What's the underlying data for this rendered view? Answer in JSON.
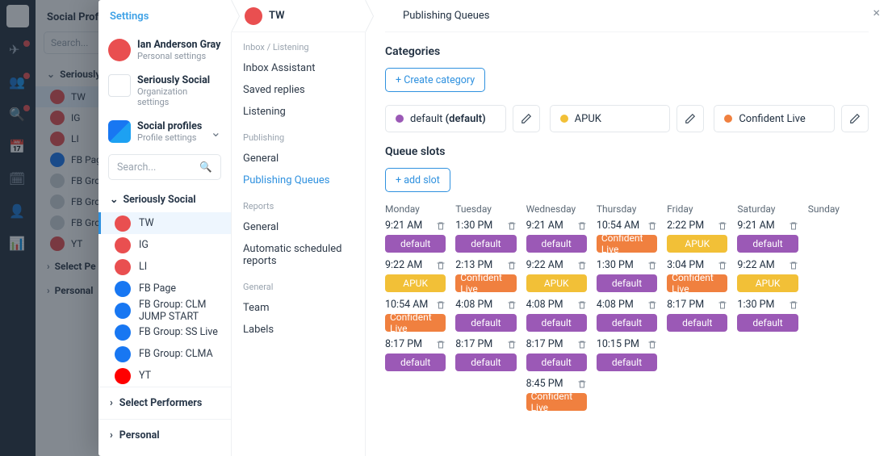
{
  "bg": {
    "panel_title": "Social Profile",
    "search_placeholder": "Search...",
    "group1": "Seriously",
    "items": [
      {
        "label": "TW",
        "net": "tw",
        "sel": true
      },
      {
        "label": "IG",
        "net": "ig"
      },
      {
        "label": "LI",
        "net": "li"
      },
      {
        "label": "FB Page",
        "net": "fb"
      },
      {
        "label": "FB Grou",
        "net": "fbdim"
      },
      {
        "label": "FB Grou",
        "net": "fbdim"
      },
      {
        "label": "FB Grou",
        "net": "fbdim"
      },
      {
        "label": "YT",
        "net": "yt"
      }
    ],
    "group2": "Select Pe",
    "group3": "Personal"
  },
  "breadcrumb": {
    "settings": "Settings",
    "profile": "TW",
    "page": "Publishing Queues"
  },
  "accounts": {
    "user": {
      "name": "Ian Anderson Gray",
      "sub": "Personal settings"
    },
    "org": {
      "name": "Seriously Social",
      "sub": "Organization settings"
    },
    "prof": {
      "name": "Social profiles",
      "sub": "Profile settings"
    }
  },
  "profile_search_placeholder": "Search...",
  "profile_group": "Seriously Social",
  "profiles": [
    {
      "label": "TW",
      "net": "tw",
      "sel": true
    },
    {
      "label": "IG",
      "net": "ig"
    },
    {
      "label": "LI",
      "net": "li"
    },
    {
      "label": "FB Page",
      "net": "fb"
    },
    {
      "label": "FB Group: CLM JUMP START",
      "net": "fb"
    },
    {
      "label": "FB Group: SS Live",
      "net": "fb"
    },
    {
      "label": "FB Group: CLMA",
      "net": "fb"
    },
    {
      "label": "YT",
      "net": "yt"
    }
  ],
  "collapsers": [
    "Select Performers",
    "Personal"
  ],
  "nav": {
    "sec1": "Inbox / Listening",
    "items1": [
      "Inbox Assistant",
      "Saved replies",
      "Listening"
    ],
    "sec2": "Publishing",
    "items2": [
      "General",
      "Publishing Queues"
    ],
    "active": "Publishing Queues",
    "sec3": "Reports",
    "items3": [
      "General",
      "Automatic scheduled reports"
    ],
    "sec4": "General",
    "items4": [
      "Team",
      "Labels"
    ]
  },
  "categories": {
    "heading": "Categories",
    "create": "+ Create category",
    "list": [
      {
        "name": "default",
        "suffix": " (default)",
        "color": "#9b59b6"
      },
      {
        "name": "APUK",
        "suffix": "",
        "color": "#f2c037"
      },
      {
        "name": "Confident Live",
        "suffix": "",
        "color": "#f0803f"
      }
    ]
  },
  "queue": {
    "heading": "Queue slots",
    "add": "+ add slot",
    "days": [
      "Monday",
      "Tuesday",
      "Wednesday",
      "Thursday",
      "Friday",
      "Saturday",
      "Sunday"
    ],
    "slots": [
      [
        {
          "t": "9:21 AM",
          "c": "default"
        },
        {
          "t": "9:22 AM",
          "c": "apuk",
          "label": "APUK"
        },
        {
          "t": "10:54 AM",
          "c": "conf",
          "label": "Confident Live"
        },
        {
          "t": "8:17 PM",
          "c": "default"
        }
      ],
      [
        {
          "t": "1:30 PM",
          "c": "default"
        },
        {
          "t": "2:13 PM",
          "c": "conf",
          "label": "Confident Live"
        },
        {
          "t": "4:08 PM",
          "c": "default"
        },
        {
          "t": "8:17 PM",
          "c": "default"
        }
      ],
      [
        {
          "t": "9:21 AM",
          "c": "default"
        },
        {
          "t": "9:22 AM",
          "c": "apuk",
          "label": "APUK"
        },
        {
          "t": "4:08 PM",
          "c": "default"
        },
        {
          "t": "8:17 PM",
          "c": "default"
        },
        {
          "t": "8:45 PM",
          "c": "conf",
          "label": "Confident Live"
        }
      ],
      [
        {
          "t": "10:54 AM",
          "c": "conf",
          "label": "Confident Live"
        },
        {
          "t": "1:30 PM",
          "c": "default"
        },
        {
          "t": "4:08 PM",
          "c": "default"
        },
        {
          "t": "10:15 PM",
          "c": "default"
        }
      ],
      [
        {
          "t": "2:22 PM",
          "c": "apuk",
          "label": "APUK"
        },
        {
          "t": "3:04 PM",
          "c": "conf",
          "label": "Confident Live"
        },
        {
          "t": "8:17 PM",
          "c": "default"
        }
      ],
      [
        {
          "t": "9:21 AM",
          "c": "default"
        },
        {
          "t": "9:22 AM",
          "c": "apuk",
          "label": "APUK"
        },
        {
          "t": "1:30 PM",
          "c": "default"
        }
      ],
      []
    ],
    "default_label": "default"
  }
}
